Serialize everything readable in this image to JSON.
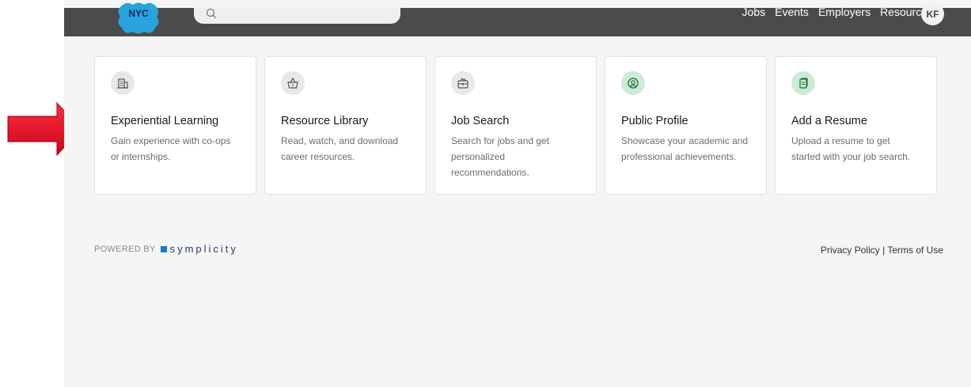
{
  "header": {
    "logo_text": "NYC",
    "search_placeholder": "",
    "nav": [
      "Jobs",
      "Events",
      "Employers",
      "Resources"
    ],
    "avatar_initials": "KF"
  },
  "cards": [
    {
      "title": "Experiential Learning",
      "desc": "Gain experience with co-ops or internships.",
      "icon": "building-icon"
    },
    {
      "title": "Resource Library",
      "desc": "Read, watch, and download career resources.",
      "icon": "basket-icon"
    },
    {
      "title": "Job Search",
      "desc": "Search for jobs and get personalized recommendations.",
      "icon": "briefcase-icon"
    },
    {
      "title": "Public Profile",
      "desc": "Showcase your academic and professional achievements.",
      "icon": "profile-icon"
    },
    {
      "title": "Add a Resume",
      "desc": "Upload a resume to get started with your job search.",
      "icon": "document-icon"
    }
  ],
  "footer": {
    "powered_by": "POWERED BY",
    "brand": "symplicity",
    "privacy": "Privacy Policy",
    "separator": " | ",
    "terms": "Terms of Use"
  },
  "colors": {
    "header_bg": "#4b4b4b",
    "page_bg": "#f5f5f5",
    "annotation_arrow": "#e8112d",
    "green_icon_bg": "#cdebd6"
  }
}
